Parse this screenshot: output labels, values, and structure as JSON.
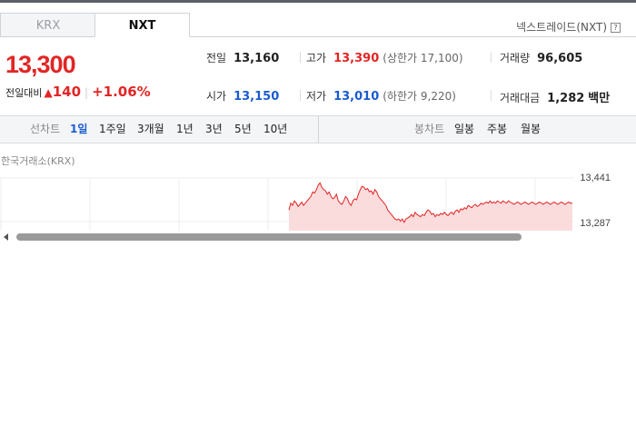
{
  "tabs": [
    {
      "label": "KRX"
    },
    {
      "label": "NXT"
    }
  ],
  "nxt_link": "넥스트레이드(NXT)",
  "price": {
    "current": "13,300",
    "change_label": "전일대비",
    "change": "140",
    "pct": "+1.06%"
  },
  "stats": {
    "prev": {
      "label": "전일",
      "value": "13,160"
    },
    "high": {
      "label": "고가",
      "value": "13,390",
      "sub": "(상한가 17,100)"
    },
    "volume": {
      "label": "거래량",
      "value": "96,605"
    },
    "open": {
      "label": "시가",
      "value": "13,150"
    },
    "low": {
      "label": "저가",
      "value": "13,010",
      "sub": "(하한가 9,220)"
    },
    "amount": {
      "label": "거래대금",
      "value": "1,282",
      "unit": "백만"
    }
  },
  "line_chart": {
    "label": "선차트",
    "periods": [
      "1일",
      "1주일",
      "3개월",
      "1년",
      "3년",
      "5년",
      "10년"
    ],
    "selected": "1일"
  },
  "candle_chart": {
    "label": "봉차트",
    "periods": [
      "일봉",
      "주봉",
      "월봉"
    ]
  },
  "chart_source": "한국거래소(KRX)",
  "chart_data": {
    "type": "area",
    "y_ticks": [
      "13,441",
      "13,287"
    ],
    "ylim": [
      13170,
      13460
    ],
    "x": [
      0,
      1,
      2,
      3,
      4,
      5,
      6,
      7,
      8,
      9,
      10,
      11,
      12,
      13,
      14,
      15,
      16,
      17,
      18,
      19,
      20,
      21,
      22,
      23,
      24,
      25,
      26,
      27,
      28,
      29,
      30,
      31,
      32,
      33,
      34,
      35,
      36,
      37,
      38,
      39,
      40,
      41,
      42,
      43,
      44,
      45,
      46,
      47,
      48,
      49,
      50,
      51,
      52,
      53,
      54,
      55,
      56,
      57,
      58,
      59,
      60,
      61,
      62,
      63,
      64,
      65,
      66,
      67,
      68,
      69,
      70,
      71,
      72,
      73,
      74,
      75,
      76,
      77,
      78,
      79,
      80,
      81,
      82,
      83,
      84,
      85,
      86,
      87,
      88,
      89,
      90,
      91,
      92,
      93,
      94,
      95,
      96,
      97,
      98,
      99,
      100,
      101,
      102,
      103,
      104,
      105,
      106,
      107,
      108,
      109,
      110,
      111,
      112,
      113,
      114,
      115,
      116,
      117,
      118,
      119,
      120,
      121,
      122,
      123,
      124,
      125,
      126,
      127,
      128,
      129,
      130,
      131,
      132,
      133,
      134,
      135,
      136,
      137,
      138,
      139,
      140,
      141,
      142,
      143,
      144,
      145,
      146,
      147,
      148,
      149,
      150,
      151,
      152,
      153,
      154,
      155
    ],
    "values": [
      13270,
      13300,
      13290,
      13310,
      13300,
      13285,
      13295,
      13305,
      13290,
      13300,
      13310,
      13320,
      13330,
      13350,
      13345,
      13360,
      13380,
      13390,
      13370,
      13360,
      13355,
      13340,
      13350,
      13330,
      13320,
      13325,
      13340,
      13310,
      13300,
      13295,
      13310,
      13330,
      13320,
      13300,
      13290,
      13310,
      13320,
      13315,
      13340,
      13360,
      13375,
      13370,
      13360,
      13365,
      13350,
      13355,
      13340,
      13360,
      13350,
      13330,
      13320,
      13310,
      13300,
      13290,
      13270,
      13260,
      13250,
      13240,
      13230,
      13225,
      13230,
      13220,
      13230,
      13215,
      13230,
      13235,
      13240,
      13250,
      13240,
      13260,
      13250,
      13245,
      13240,
      13250,
      13245,
      13260,
      13270,
      13265,
      13250,
      13255,
      13240,
      13250,
      13245,
      13255,
      13250,
      13260,
      13250,
      13245,
      13255,
      13260,
      13250,
      13265,
      13270,
      13260,
      13275,
      13270,
      13280,
      13275,
      13290,
      13285,
      13280,
      13290,
      13295,
      13285,
      13290,
      13300,
      13295,
      13300,
      13305,
      13300,
      13310,
      13300,
      13305,
      13300,
      13310,
      13305,
      13300,
      13310,
      13305,
      13300,
      13310,
      13305,
      13300,
      13295,
      13300,
      13305,
      13300,
      13295,
      13300,
      13305,
      13300,
      13295,
      13300,
      13305,
      13300,
      13295,
      13300,
      13305,
      13300,
      13295,
      13300,
      13305,
      13300,
      13295,
      13300,
      13305,
      13300,
      13295,
      13300,
      13305,
      13300,
      13295,
      13300,
      13305,
      13300,
      13300
    ]
  }
}
